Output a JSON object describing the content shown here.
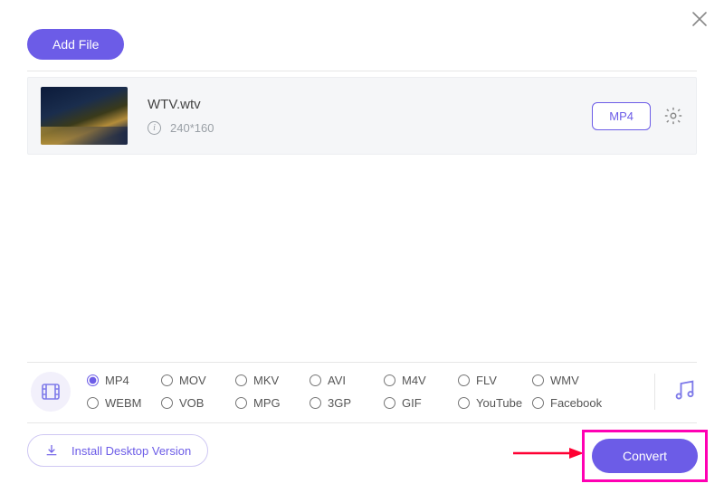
{
  "header": {
    "add_file_label": "Add File"
  },
  "file": {
    "name": "WTV.wtv",
    "resolution": "240*160",
    "target_format": "MP4"
  },
  "formats": {
    "selected": "MP4",
    "items": [
      "MP4",
      "MOV",
      "MKV",
      "AVI",
      "M4V",
      "FLV",
      "WMV",
      "WEBM",
      "VOB",
      "MPG",
      "3GP",
      "GIF",
      "YouTube",
      "Facebook"
    ]
  },
  "footer": {
    "install_label": "Install Desktop Version",
    "convert_label": "Convert"
  }
}
